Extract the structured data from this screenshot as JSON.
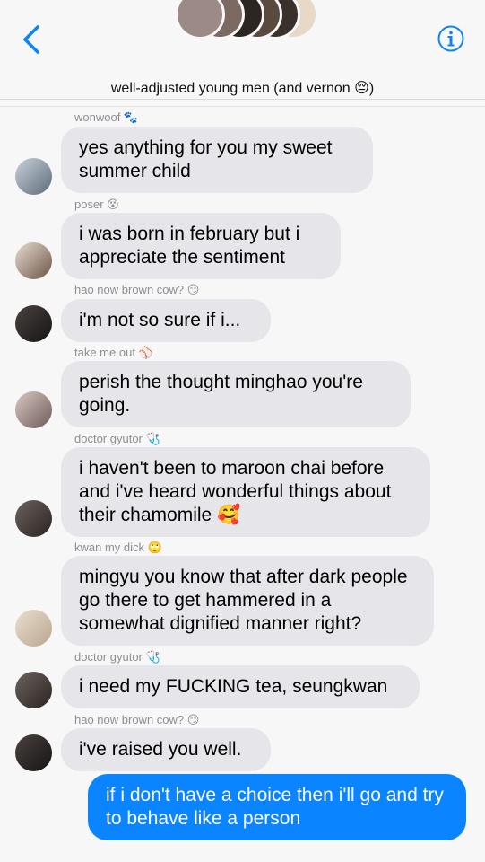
{
  "header": {
    "title": "well-adjusted young men (and vernon 😔)"
  },
  "messages": [
    {
      "sender": "wonwoof 🐾",
      "text": "yes anything for you my sweet summer child"
    },
    {
      "sender": "poser 😵",
      "text": "i was born in february but i appreciate the sentiment"
    },
    {
      "sender": "hao now brown cow? 😏",
      "text": "i'm not so sure if i..."
    },
    {
      "sender": "take me out ⚾",
      "text": "perish the thought minghao you're going."
    },
    {
      "sender": "doctor gyutor 🩺",
      "text": "i haven't been to maroon chai before and i've heard wonderful things about their chamomile 🥰"
    },
    {
      "sender": "kwan my dick 🙄",
      "text": "mingyu you know that after dark people go there to get hammered in a somewhat dignified manner right?"
    },
    {
      "sender": "doctor gyutor 🩺",
      "text": "i need my FUCKING tea, seungkwan"
    },
    {
      "sender": "hao now brown cow? 😏",
      "text": "i've raised you well."
    },
    {
      "sender": "",
      "text": "if i don't have a choice then i'll go and try to behave like a person"
    }
  ]
}
